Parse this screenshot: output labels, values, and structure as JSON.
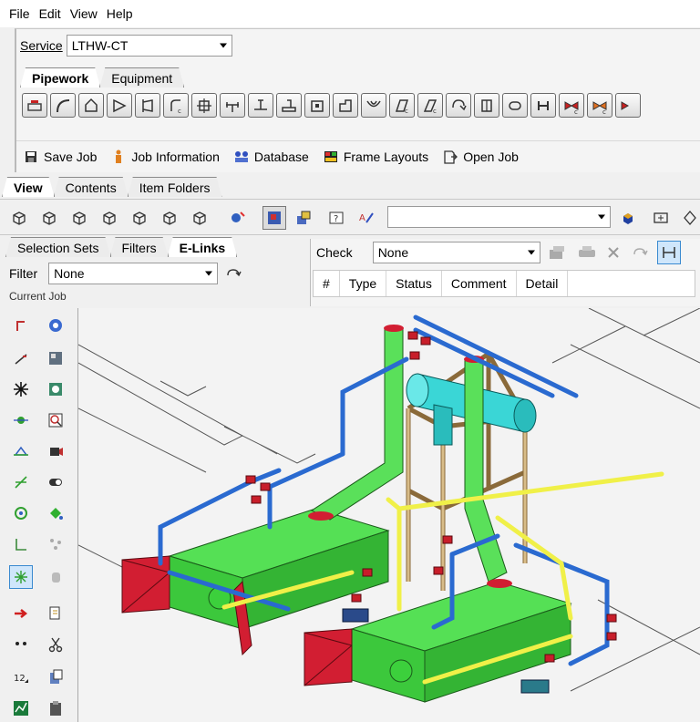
{
  "menu": [
    "File",
    "Edit",
    "View",
    "Help"
  ],
  "service": {
    "label": "Service",
    "value": "LTHW-CT"
  },
  "top_tabs": [
    "Pipework",
    "Equipment"
  ],
  "job_toolbar": {
    "save_job": "Save Job",
    "job_information": "Job Information",
    "database": "Database",
    "frame_layouts": "Frame Layouts",
    "open_job": "Open Job"
  },
  "view_tabs": [
    "View",
    "Contents",
    "Item Folders"
  ],
  "left_tabs": [
    "Selection Sets",
    "Filters",
    "E-Links"
  ],
  "filter": {
    "label": "Filter",
    "value": "None"
  },
  "current_job_label": "Current Job",
  "check": {
    "label": "Check",
    "value": "None"
  },
  "check_table_headers": [
    "#",
    "Type",
    "Status",
    "Comment",
    "Detail"
  ],
  "colors": {
    "duct_green": "#3cd03c",
    "tank_cyan": "#3ad6d6",
    "pipe_blue": "#2a6ad0",
    "pipe_yellow": "#f0f048",
    "frame_tan": "#c8aa78",
    "valve_red": "#c81e2a",
    "damper_red": "#d21e32"
  }
}
